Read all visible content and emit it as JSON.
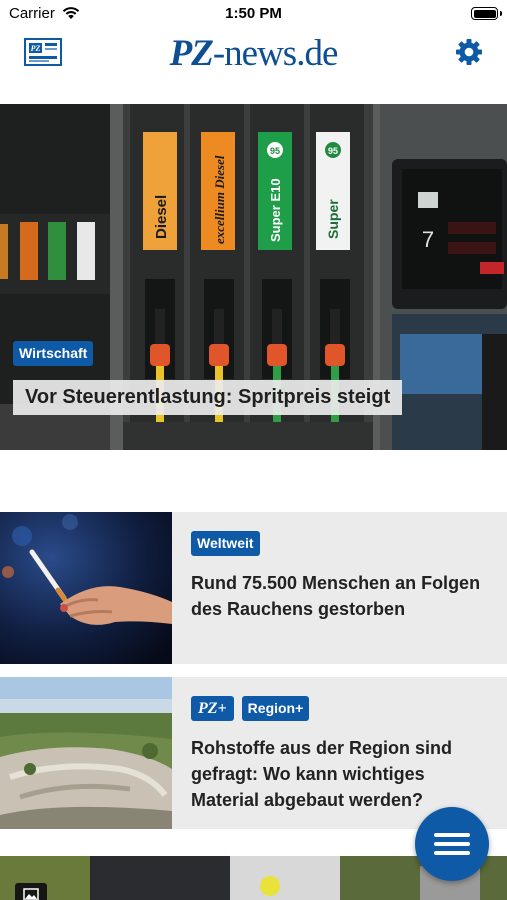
{
  "status_bar": {
    "carrier": "Carrier",
    "time": "1:50 PM"
  },
  "header": {
    "logo_pz": "PZ",
    "logo_rest": "-news.de",
    "brand_color": "#0e4f94"
  },
  "hero": {
    "category": "Wirtschaft",
    "title": "Vor Steuerentlastung: Spritpreis steigt",
    "pump_labels": [
      "Diesel",
      "excellium Diesel",
      "Super E10",
      "Super"
    ],
    "pump_badges": [
      "95",
      "95"
    ]
  },
  "articles": [
    {
      "tags": [
        "Weltweit"
      ],
      "title": "Rund 75.500 Menschen an Folgen des Rauchens gestorben"
    },
    {
      "premium_badge": "PZ+",
      "tags": [
        "Region+"
      ],
      "title": "Rohstoffe aus der Region sind gefragt: Wo kann wichtiges Material abgebaut werden?"
    }
  ],
  "icons": {
    "epaper": "epaper-icon",
    "settings": "gear-icon",
    "menu": "hamburger-menu-icon",
    "photo": "photo-icon"
  },
  "colors": {
    "accent": "#0e5aa7",
    "card_background": "#ebebeb"
  }
}
